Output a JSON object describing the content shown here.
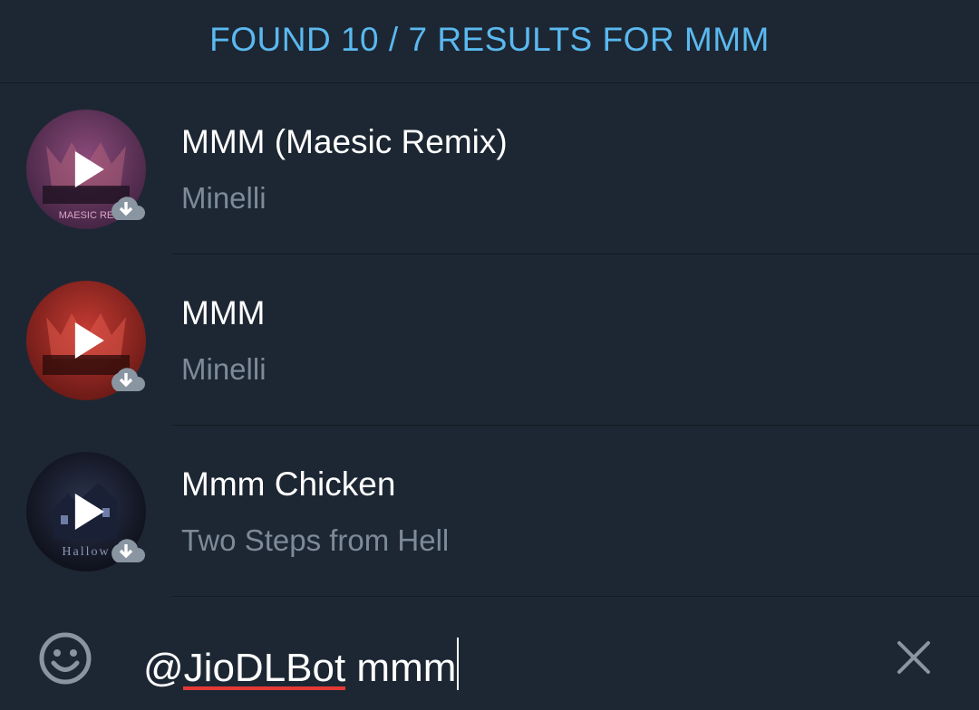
{
  "header": {
    "title": "FOUND 10 / 7 RESULTS FOR MMM"
  },
  "results": [
    {
      "title": "MMM (Maesic Remix)",
      "artist": "Minelli",
      "thumb_text": "MAESIC RE",
      "thumb_icon": "play-icon",
      "badge_icon": "download-icon"
    },
    {
      "title": "MMM",
      "artist": "Minelli",
      "thumb_text": "",
      "thumb_icon": "play-icon",
      "badge_icon": "download-icon"
    },
    {
      "title": "Mmm Chicken",
      "artist": "Two Steps from Hell",
      "thumb_text": "Hallow",
      "thumb_icon": "play-icon",
      "badge_icon": "download-icon"
    }
  ],
  "footer": {
    "emoji_icon": "emoji-icon",
    "input_mention": "@JioDLBot",
    "input_query": " mmm",
    "close_icon": "close-icon"
  },
  "colors": {
    "background": "#1d2733",
    "accent": "#5ab9f0",
    "subtitle": "#7d8a98",
    "spellcheck_underline": "#e53935"
  }
}
